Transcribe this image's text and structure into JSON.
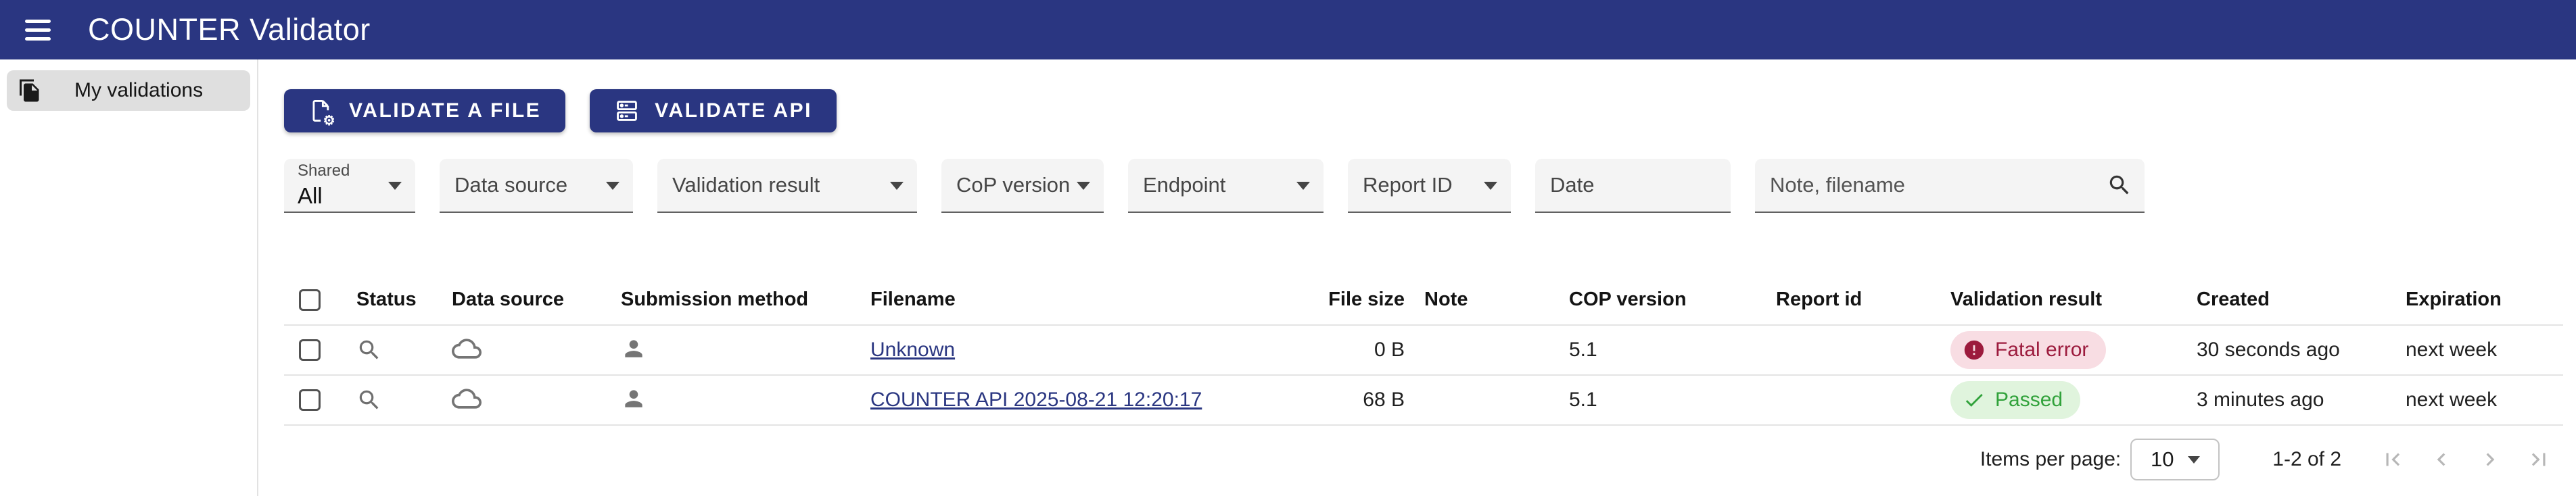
{
  "app": {
    "title": "COUNTER Validator"
  },
  "colors": {
    "brand": "#2a3681",
    "error_fg": "#9c1b3d",
    "error_bg": "#f8dde3",
    "success_fg": "#31a23b",
    "success_bg": "#e0f4dd"
  },
  "sidebar": {
    "items": [
      {
        "label": "My validations",
        "icon": "documents-icon",
        "active": true
      }
    ]
  },
  "toolbar": {
    "buttons": [
      {
        "label": "VALIDATE A FILE",
        "icon": "file-gear-icon"
      },
      {
        "label": "VALIDATE API",
        "icon": "server-icon"
      }
    ]
  },
  "filters": {
    "shared": {
      "label": "Shared",
      "value": "All"
    },
    "selects": [
      "Data source",
      "Validation result",
      "CoP version",
      "Endpoint",
      "Report ID"
    ],
    "date": {
      "label": "Date"
    },
    "search": {
      "placeholder": "Note, filename",
      "icon": "search-icon"
    }
  },
  "table": {
    "columns": [
      "Status",
      "Data source",
      "Submission method",
      "Filename",
      "File size",
      "Note",
      "COP version",
      "Report id",
      "Validation result",
      "Created",
      "Expiration"
    ],
    "rows": [
      {
        "status_icon": "magnifier-icon",
        "data_source_icon": "cloud-icon",
        "submission_icon": "person-icon",
        "filename": "Unknown",
        "file_size": "0 B",
        "note": "",
        "cop_version": "5.1",
        "report_id": "",
        "result": "Fatal error",
        "result_kind": "error",
        "created": "30 seconds ago",
        "expiration": "next week"
      },
      {
        "status_icon": "magnifier-icon",
        "data_source_icon": "cloud-icon",
        "submission_icon": "person-icon",
        "filename": "COUNTER API 2025-08-21 12:20:17",
        "file_size": "68 B",
        "note": "",
        "cop_version": "5.1",
        "report_id": "",
        "result": "Passed",
        "result_kind": "success",
        "created": "3 minutes ago",
        "expiration": "next week"
      }
    ]
  },
  "pagination": {
    "items_per_page_label": "Items per page:",
    "items_per_page": "10",
    "range": "1-2 of 2"
  }
}
